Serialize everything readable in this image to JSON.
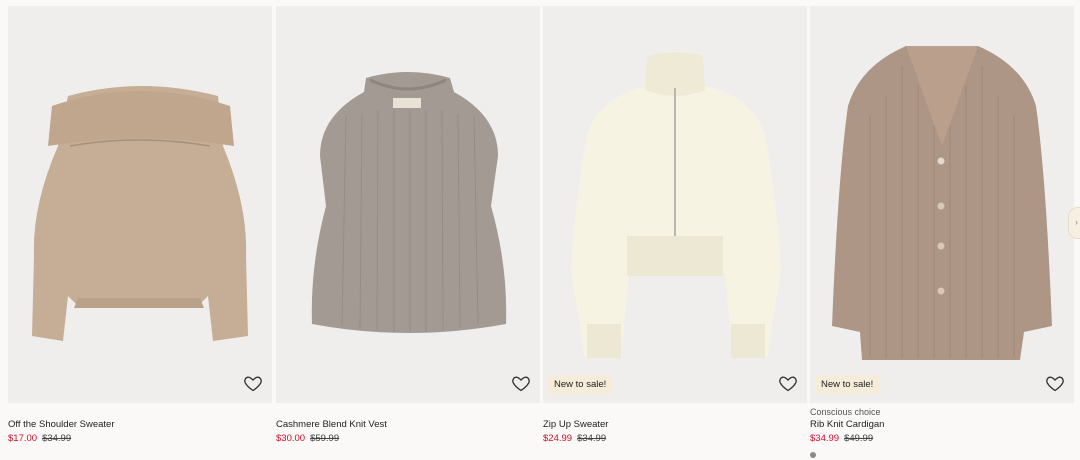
{
  "products": [
    {
      "eyebrow": "",
      "title": "Off the Shoulder Sweater",
      "price_sale": "$17.00",
      "price_old": "$34.99",
      "badge": "",
      "icon": "heart-icon",
      "color": "#c6ad95"
    },
    {
      "eyebrow": "",
      "title": "Cashmere Blend Knit Vest",
      "price_sale": "$30.00",
      "price_old": "$59.99",
      "badge": "",
      "icon": "heart-icon",
      "color": "#a39a93"
    },
    {
      "eyebrow": "",
      "title": "Zip Up Sweater",
      "price_sale": "$24.99",
      "price_old": "$34.99",
      "badge": "New to sale!",
      "icon": "heart-icon",
      "color": "#f6f3e3"
    },
    {
      "eyebrow": "Conscious choice",
      "title": "Rib Knit Cardigan",
      "price_sale": "$34.99",
      "price_old": "$49.99",
      "badge": "New to sale!",
      "icon": "heart-icon",
      "color": "#ad9686"
    }
  ],
  "colors": {
    "sale_price": "#c8102e",
    "badge_bg": "#f5ecd9",
    "image_bg": "#efeeec"
  }
}
